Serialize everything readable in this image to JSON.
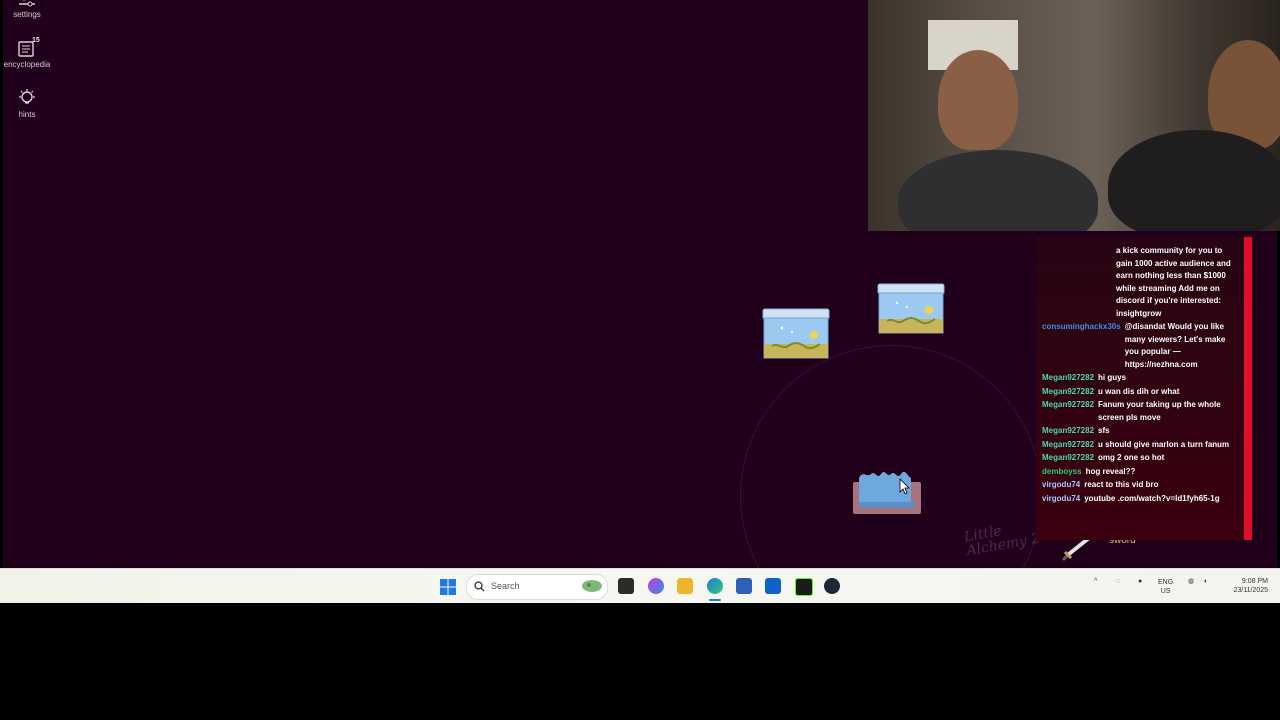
{
  "game": {
    "sidebar": {
      "settings_label": "settings",
      "encyclopedia_label": "encyclopedia",
      "encyclopedia_count": "15",
      "hints_label": "hints"
    },
    "elements": [
      "aquarium",
      "aquarium",
      "bucket"
    ],
    "watermark_line1": "Little",
    "watermark_line2": "Alchemy 2",
    "sword_label": "sword"
  },
  "chat": {
    "messages": [
      {
        "user": "",
        "text": "a kick community for you to gain 1000 active audience and earn nothing less than $1000 while streaming Add me on discord if you're interested: insightgrow",
        "color": "#ffffff"
      },
      {
        "user": "consuminghackx30s",
        "text": "@disandat Would you like many viewers? Let's make you popular — https://nezhna.com",
        "color": "#3a8ee6"
      },
      {
        "user": "Megan927282",
        "text": "hi guys",
        "color": "#4fd6a8"
      },
      {
        "user": "Megan927282",
        "text": "u wan dis dih or what",
        "color": "#4fd6a8"
      },
      {
        "user": "Megan927282",
        "text": "Fanum your taking up the whole screen pls move",
        "color": "#4fd6a8"
      },
      {
        "user": "Megan927282",
        "text": "sfs",
        "color": "#4fd6a8"
      },
      {
        "user": "Megan927282",
        "text": "u should give marlon a turn fanum",
        "color": "#4fd6a8"
      },
      {
        "user": "Megan927282",
        "text": "omg 2 one so hot",
        "color": "#4fd6a8"
      },
      {
        "user": "demboyss",
        "text": "hog reveal??",
        "color": "#2ecc71"
      },
      {
        "user": "virgodu74",
        "text": "react to this vid bro",
        "color": "#a8c8ff"
      },
      {
        "user": "virgodu74",
        "text": "youtube .com/watch?v=ld1fyh65-1g",
        "color": "#a8c8ff"
      }
    ]
  },
  "taskbar": {
    "search_placeholder": "Search",
    "lang_top": "ENG",
    "lang_bottom": "US",
    "time": "9:08 PM",
    "date": "23/11/2025"
  },
  "colors": {
    "game_bg": "#21001b",
    "chat_border": "#e0102a",
    "sword_label": "#e7b58f"
  }
}
